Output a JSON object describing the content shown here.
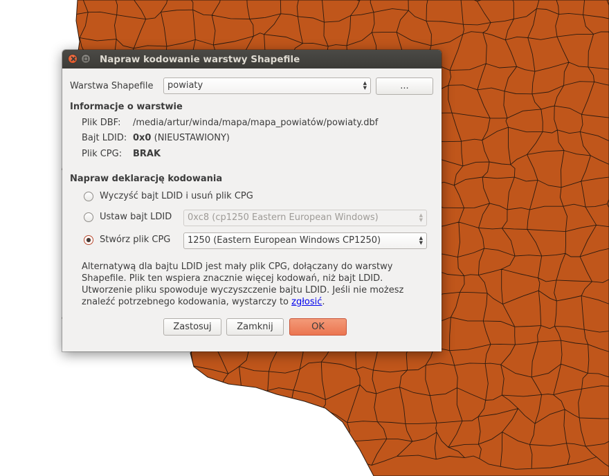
{
  "dialog": {
    "title": "Napraw kodowanie warstwy Shapefile",
    "layer_label": "Warstwa Shapefile",
    "layer_value": "powiaty",
    "browse_label": "...",
    "info_heading": "Informacje o warstwie",
    "dbf_label": "Plik DBF:",
    "dbf_value": "/media/artur/winda/mapa/mapa_powiatów/powiaty.dbf",
    "ldid_label": "Bajt LDID:",
    "ldid_value_bold": "0x0",
    "ldid_value_rest": "(NIEUSTAWIONY)",
    "cpg_label": "Plik CPG:",
    "cpg_value": "BRAK",
    "fix_heading": "Napraw deklarację kodowania",
    "options": [
      {
        "label": "Wyczyść bajt LDID i usuń plik CPG",
        "checked": false
      },
      {
        "label": "Ustaw bajt LDID",
        "checked": false,
        "combo": "0xc8 (cp1250 Eastern European Windows)",
        "enabled": false
      },
      {
        "label": "Stwórz plik CPG",
        "checked": true,
        "combo": "1250 (Eastern European Windows CP1250)",
        "enabled": true
      }
    ],
    "info_lines": [
      "Alternatywą dla bajtu LDID jest mały plik CPG, dołączany do warstwy",
      "Shapefile. Plik ten wspiera znacznie więcej kodowań, niż bajt LDID.",
      "Utworzenie pliku spowoduje wyczyszczenie bajtu LDID. Jeśli nie możesz",
      "znaleźć potrzebnego kodowania, wystarczy to"
    ],
    "info_link": "zgłosić",
    "info_end": ".",
    "buttons": {
      "apply": "Zastosuj",
      "close": "Zamknij",
      "ok": "OK"
    }
  },
  "colors": {
    "map_fill": "#c0561b",
    "map_stroke": "#2a1a10",
    "accent": "#eb7550"
  }
}
